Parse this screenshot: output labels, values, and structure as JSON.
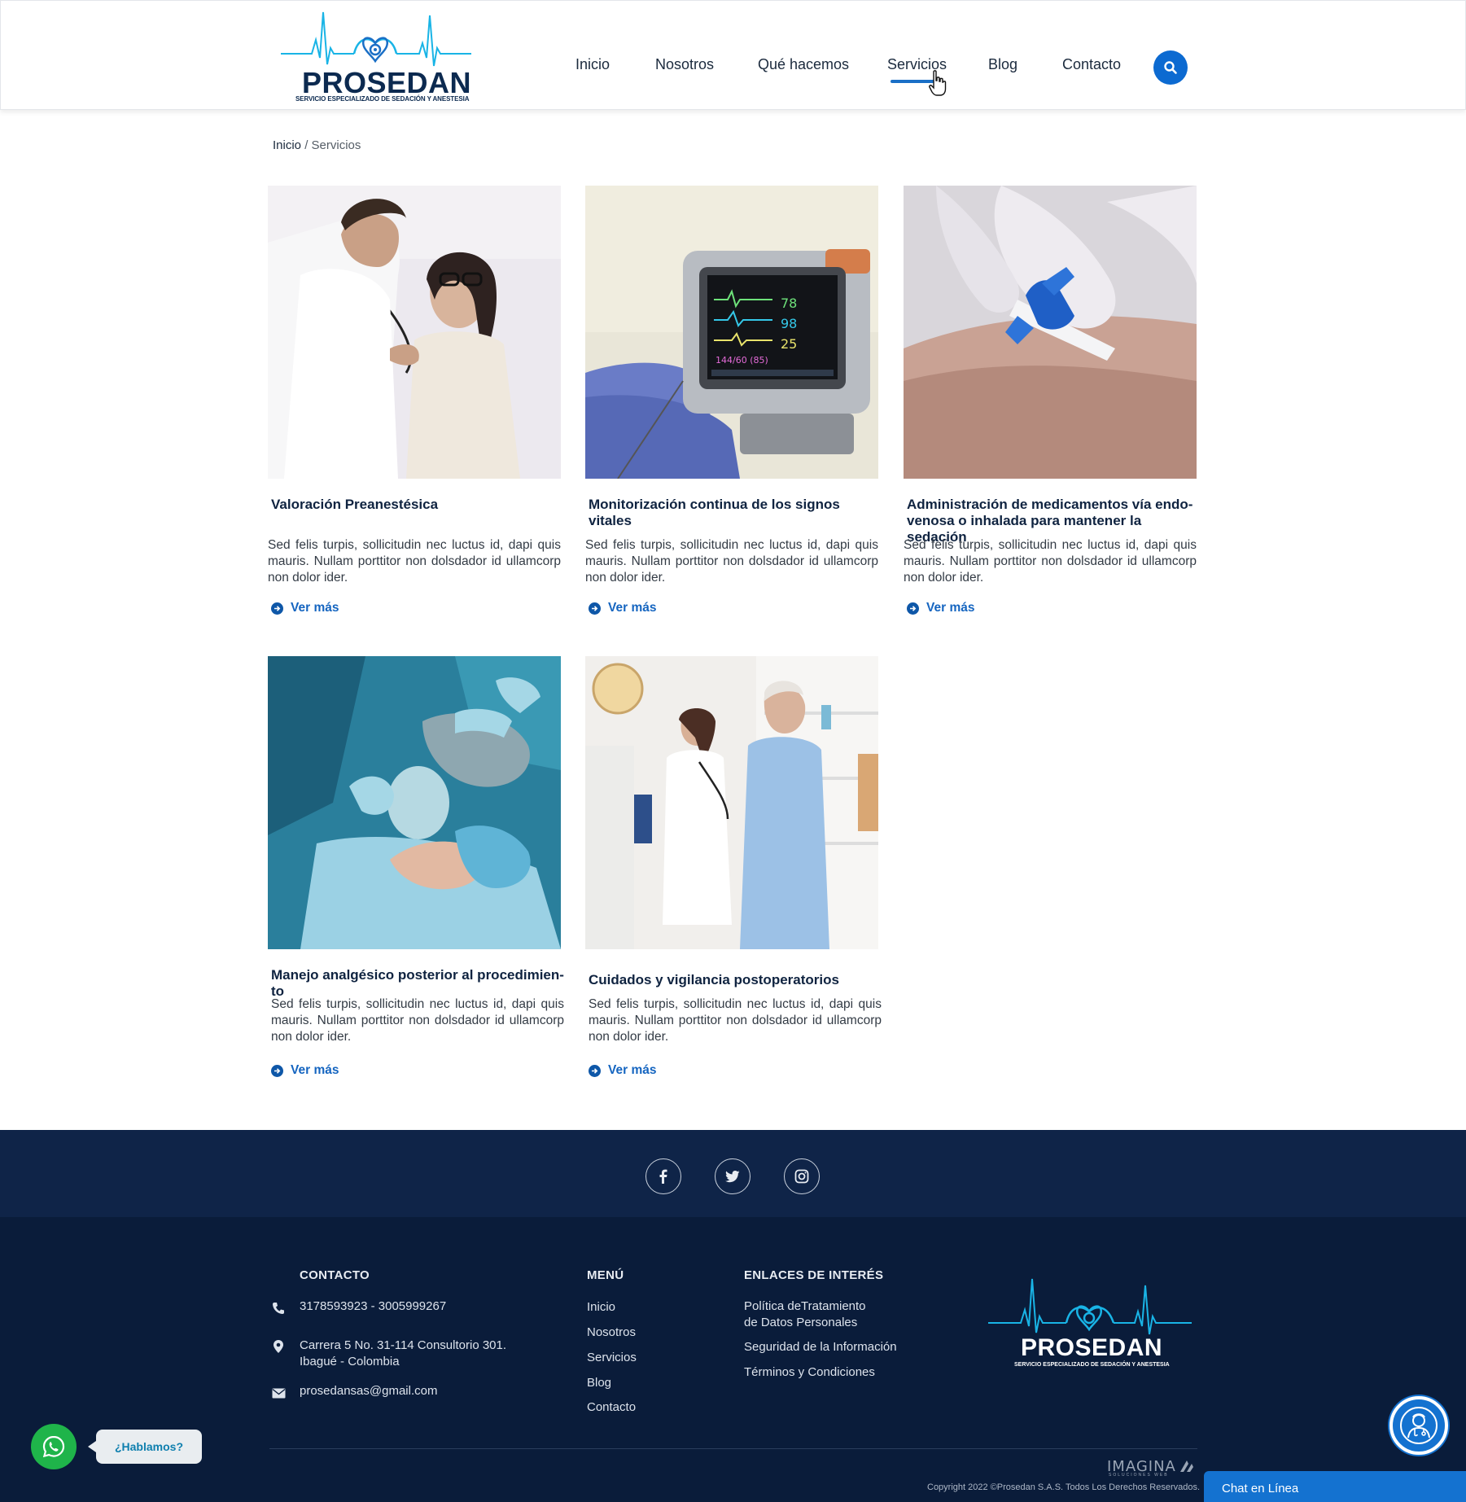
{
  "header": {
    "logo": {
      "name": "PROSEDAN",
      "tagline": "SERVICIO ESPECIALIZADO DE SEDACIÓN Y ANESTESIA"
    },
    "nav": [
      {
        "label": "Inicio"
      },
      {
        "label": "Nosotros"
      },
      {
        "label": "Qué hacemos"
      },
      {
        "label": "Servicios",
        "active": true
      },
      {
        "label": "Blog"
      },
      {
        "label": "Contacto"
      }
    ],
    "search_icon": "search-icon"
  },
  "breadcrumb": {
    "home": "Inicio",
    "separator": " / ",
    "current": "Servicios"
  },
  "services": [
    {
      "title": "Valoración  Preanestésica",
      "text": "Sed felis turpis, sollicitudin nec luctus id, dapi quis mauris. Nullam porttitor non dolsdador id  ullamcorp non dolor ider.",
      "link": "Ver más",
      "image": "doctor examining woman with stethoscope"
    },
    {
      "title": "Monitorización continua de los signos vitales",
      "text": "Sed felis turpis, sollicitudin nec luctus id, dapi quis mauris. Nullam porttitor non dolsdador id  ullamcorp non dolor ider.",
      "link": "Ver más",
      "image": "vital signs monitor"
    },
    {
      "title": "Administración de medicamentos vía endo-venosa o inhalada para mantener la sedación",
      "text": "Sed felis turpis, sollicitudin nec luctus id, dapi quis mauris. Nullam porttitor non dolsdador id  ullamcorp non dolor ider.",
      "link": "Ver más",
      "image": "IV catheter in arm"
    },
    {
      "title": "Manejo analgésico posterior al procedimien-to",
      "text": "Sed felis turpis, sollicitudin nec luctus id, dapi quis mauris. Nullam porttitor non dolsdador id  ullamcorp non dolor ider.",
      "link": "Ver más",
      "image": "anesthesia mask in operating room"
    },
    {
      "title": "Cuidados y vigilancia postoperatorios",
      "text": "Sed felis turpis, sollicitudin nec luctus id, dapi quis mauris. Nullam porttitor non dolsdador id  ullamcorp non dolor ider.",
      "link": "Ver más",
      "image": "doctor examining elderly man"
    }
  ],
  "social": [
    "facebook-icon",
    "twitter-icon",
    "instagram-icon"
  ],
  "footer": {
    "contact": {
      "heading": "CONTACTO",
      "phone": "3178593923 - 3005999267",
      "address_line1": "Carrera 5 No. 31-114 Consultorio 301.",
      "address_line2": "Ibagué - Colombia",
      "email": "prosedansas@gmail.com"
    },
    "menu": {
      "heading": "MENÚ",
      "items": [
        "Inicio",
        "Nosotros",
        "Servicios",
        "Blog",
        "Contacto"
      ]
    },
    "links": {
      "heading": "ENLACES DE INTERÉS",
      "items": [
        {
          "line1": "Política deTratamiento",
          "line2": "de Datos Personales"
        },
        {
          "line1": "Seguridad de la Información"
        },
        {
          "line1": "Términos y Condiciones"
        }
      ]
    },
    "logo": {
      "name": "PROSEDAN",
      "tagline": "SERVICIO ESPECIALIZADO DE SEDACIÓN Y ANESTESIA"
    },
    "credit": {
      "name": "IMAGINA",
      "sub": "SOLUCIONES WEB"
    },
    "copyright": "Copyright 2022 ©Prosedan S.A.S. Todos Los Derechos Reservados."
  },
  "whatsapp": {
    "label": "¿Hablamos?"
  },
  "chat": {
    "label": "Chat en Línea"
  },
  "colors": {
    "brand_blue": "#0c6ad1",
    "navy": "#0a1c3a",
    "accent_cyan": "#19b4e6",
    "whatsapp_green": "#1fb44a"
  }
}
